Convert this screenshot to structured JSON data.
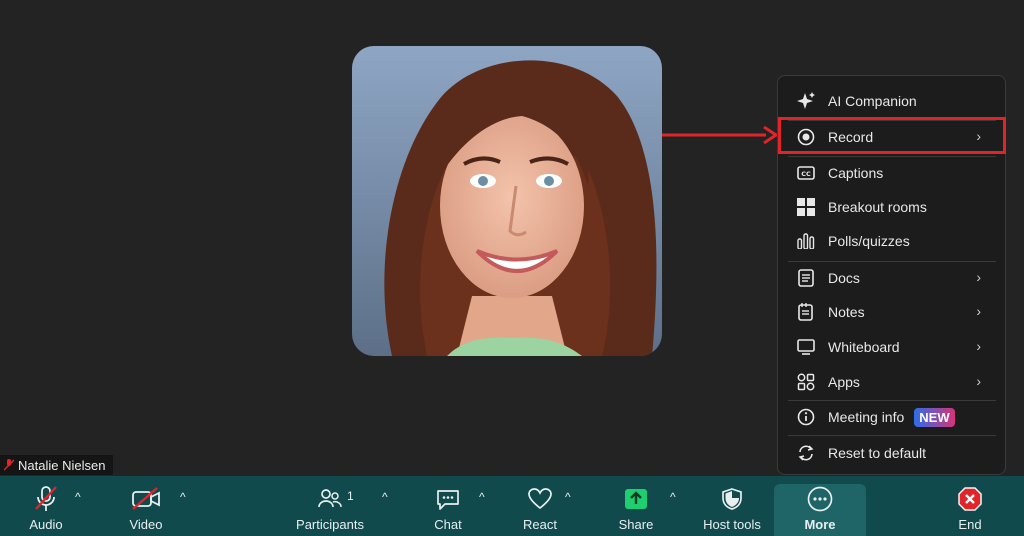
{
  "participant": {
    "name": "Natalie Nielsen"
  },
  "menu": {
    "items": [
      {
        "label": "AI Companion",
        "icon": "sparkle-icon"
      },
      {
        "label": "Record",
        "icon": "record-icon",
        "submenu": true,
        "highlighted": true
      },
      {
        "label": "Captions",
        "icon": "captions-icon"
      },
      {
        "label": "Breakout rooms",
        "icon": "breakout-rooms-icon"
      },
      {
        "label": "Polls/quizzes",
        "icon": "polls-icon"
      },
      {
        "label": "Docs",
        "icon": "docs-icon",
        "submenu": true
      },
      {
        "label": "Notes",
        "icon": "notes-icon",
        "submenu": true
      },
      {
        "label": "Whiteboard",
        "icon": "whiteboard-icon",
        "submenu": true
      },
      {
        "label": "Apps",
        "icon": "apps-icon",
        "submenu": true
      },
      {
        "label": "Meeting info",
        "icon": "info-icon",
        "badge": "NEW"
      },
      {
        "label": "Reset to default",
        "icon": "reset-icon"
      }
    ],
    "chevron": "›"
  },
  "toolbar": {
    "audio": "Audio",
    "video": "Video",
    "participants": "Participants",
    "participants_count": "1",
    "chat": "Chat",
    "react": "React",
    "share": "Share",
    "host_tools": "Host tools",
    "more": "More",
    "end": "End",
    "caret": "^"
  },
  "colors": {
    "toolbar_bg": "#114a4d",
    "highlight": "#e0242a",
    "share_green": "#1fce6f",
    "end_red": "#e0242a"
  }
}
